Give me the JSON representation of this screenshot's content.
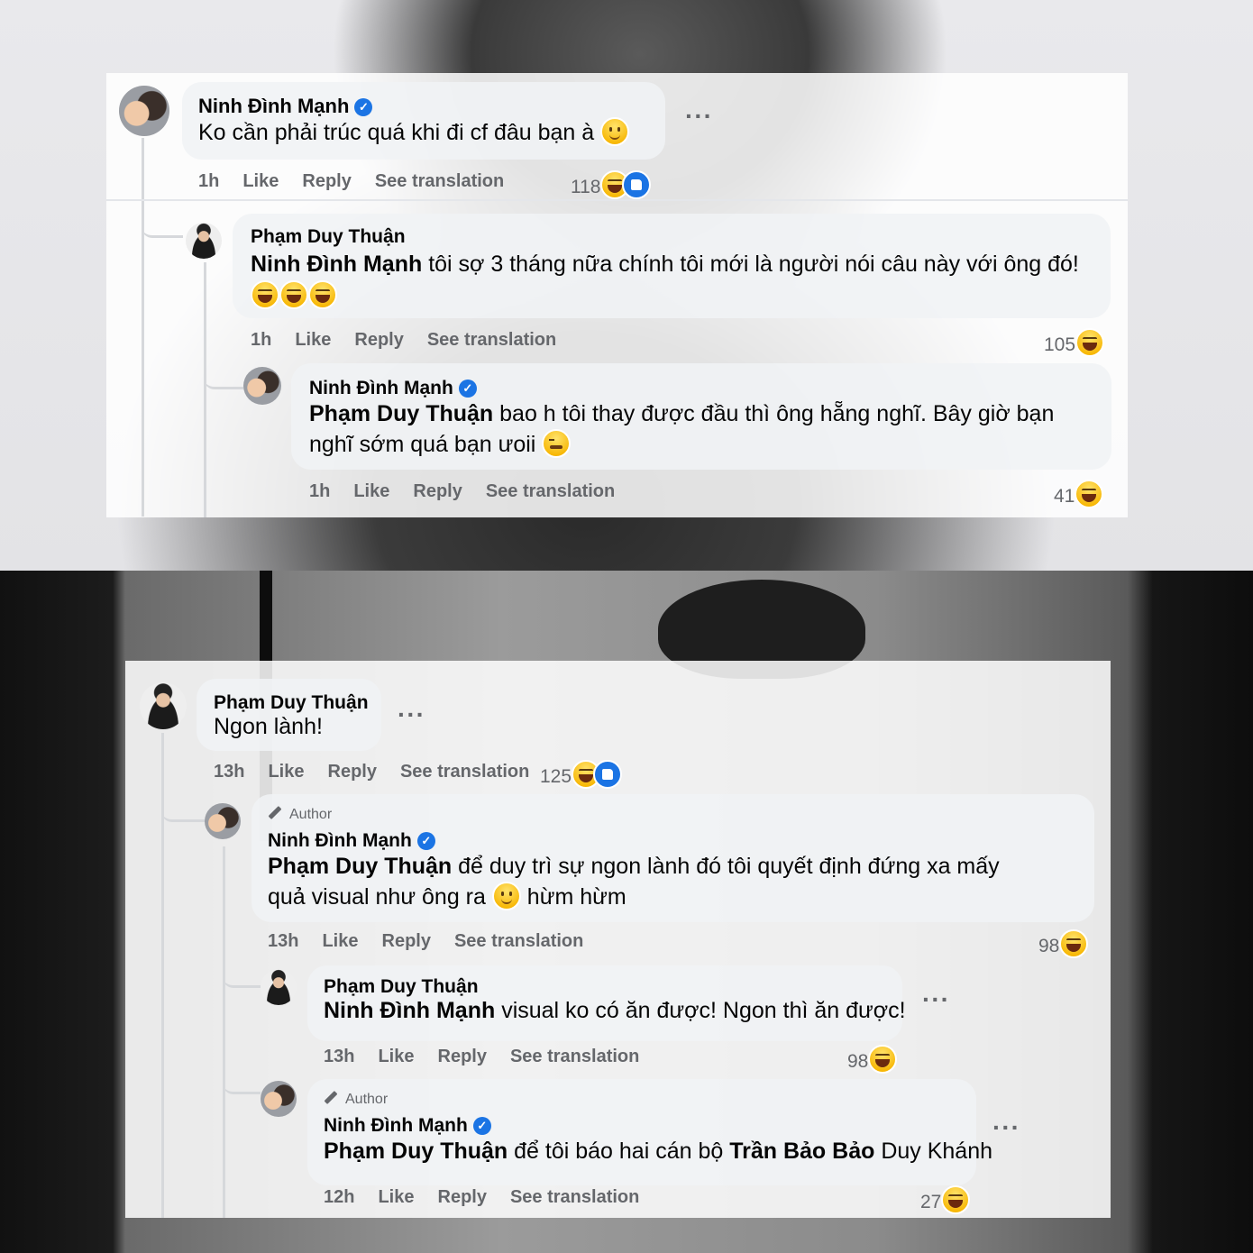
{
  "colors": {
    "link_blue": "#1b74e4",
    "text": "#050505",
    "meta": "#65676b",
    "bubble": "#f0f2f5"
  },
  "comments": [
    {
      "name": "Ninh Đình Mạnh",
      "verified": true,
      "text": "Ko cần phải trúc quá khi đi cf đâu bạn à",
      "emoji": "smile",
      "time": "1h",
      "like": "Like",
      "reply": "Reply",
      "translate": "See translation",
      "count": "118",
      "reactions": [
        "laugh",
        "like"
      ]
    },
    {
      "name": "Phạm Duy Thuận",
      "mention": "Ninh Đình Mạnh",
      "text": " tôi sợ 3 tháng nữa chính tôi mới là người nói câu này với ông đó!",
      "emoji": "laugh x3",
      "time": "1h",
      "like": "Like",
      "reply": "Reply",
      "translate": "See translation",
      "count": "105",
      "reactions": [
        "laugh"
      ]
    },
    {
      "name": "Ninh Đình Mạnh",
      "verified": true,
      "mention": "Phạm Duy Thuận",
      "text": " bao h tôi thay được đầu thì ông hẵng nghĩ. Bây giờ bạn nghĩ sớm quá bạn ưoii",
      "emoji": "tired",
      "time": "1h",
      "like": "Like",
      "reply": "Reply",
      "translate": "See translation",
      "count": "41",
      "reactions": [
        "laugh"
      ]
    },
    {
      "name": "Phạm Duy Thuận",
      "text": "Ngon lành!",
      "time": "13h",
      "like": "Like",
      "reply": "Reply",
      "translate": "See translation",
      "count": "125",
      "reactions": [
        "laugh",
        "like"
      ]
    },
    {
      "badge": "Author",
      "name": "Ninh Đình Mạnh",
      "verified": true,
      "mention": "Phạm Duy Thuận",
      "text": " để duy trì sự ngon lành đó tôi quyết định đứng xa mấy quả visual như ông ra",
      "emoji": "smile",
      "text_after": " hừm hừm",
      "time": "13h",
      "like": "Like",
      "reply": "Reply",
      "translate": "See translation",
      "count": "98",
      "reactions": [
        "laugh"
      ]
    },
    {
      "name": "Phạm Duy Thuận",
      "mention": "Ninh Đình Mạnh",
      "text": " visual ko có ăn được! Ngon thì ăn được!",
      "time": "13h",
      "like": "Like",
      "reply": "Reply",
      "translate": "See translation",
      "count": "98",
      "reactions": [
        "laugh"
      ]
    },
    {
      "badge": "Author",
      "name": "Ninh Đình Mạnh",
      "verified": true,
      "mention": "Phạm Duy Thuận",
      "text_mid": " để tôi báo hai cán bộ ",
      "mention2": "Trần Bảo Bảo",
      "text": " Duy Khánh",
      "time": "12h",
      "like": "Like",
      "reply": "Reply",
      "translate": "See translation",
      "count": "27",
      "reactions": [
        "laugh"
      ]
    }
  ]
}
